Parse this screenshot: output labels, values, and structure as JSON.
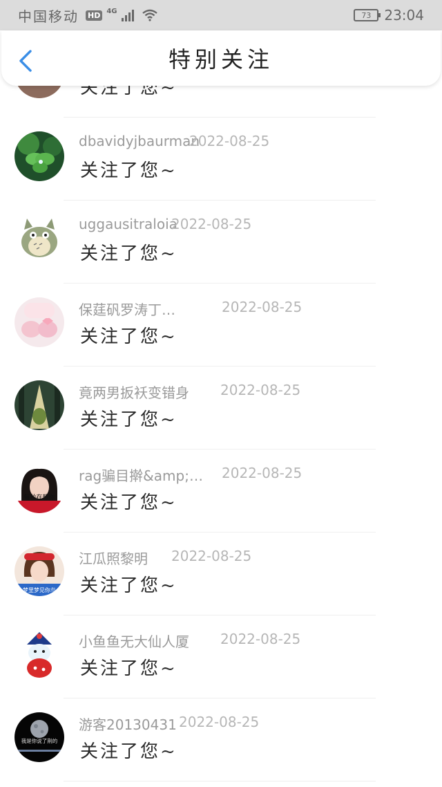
{
  "status_bar": {
    "carrier": "中国移动",
    "hd": "HD",
    "network": "4G",
    "battery": "73",
    "time": "23:04"
  },
  "nav": {
    "title": "特别关注",
    "back_icon": "chevron-left-icon",
    "accent_color": "#3a8ee6"
  },
  "items": [
    {
      "name": "",
      "date": "",
      "message": "关注了您~"
    },
    {
      "name": "dbavidyjbaurman",
      "date": "2022-08-25",
      "message": "关注了您~"
    },
    {
      "name": "uggausitraloia",
      "date": "2022-08-25",
      "message": "关注了您~"
    },
    {
      "name": "保莛矾罗涛丁…",
      "date": "2022-08-25",
      "message": "关注了您~"
    },
    {
      "name": "竟两男扳袄变错身",
      "date": "2022-08-25",
      "message": "关注了您~"
    },
    {
      "name": "rag骗目擀&amp;…",
      "date": "2022-08-25",
      "message": "关注了您~"
    },
    {
      "name": "江瓜照黎明",
      "date": "2022-08-25",
      "message": "关注了您~"
    },
    {
      "name": "小鱼鱼无大仙人厦",
      "date": "2022-08-25",
      "message": "关注了您~"
    },
    {
      "name": "游客20130431",
      "date": "2022-08-25",
      "message": "关注了您~"
    }
  ],
  "avatar_captions": {
    "a5": "每秒在想你",
    "a6": "梦里梦见你与",
    "a8": "我是你说了荆的"
  }
}
